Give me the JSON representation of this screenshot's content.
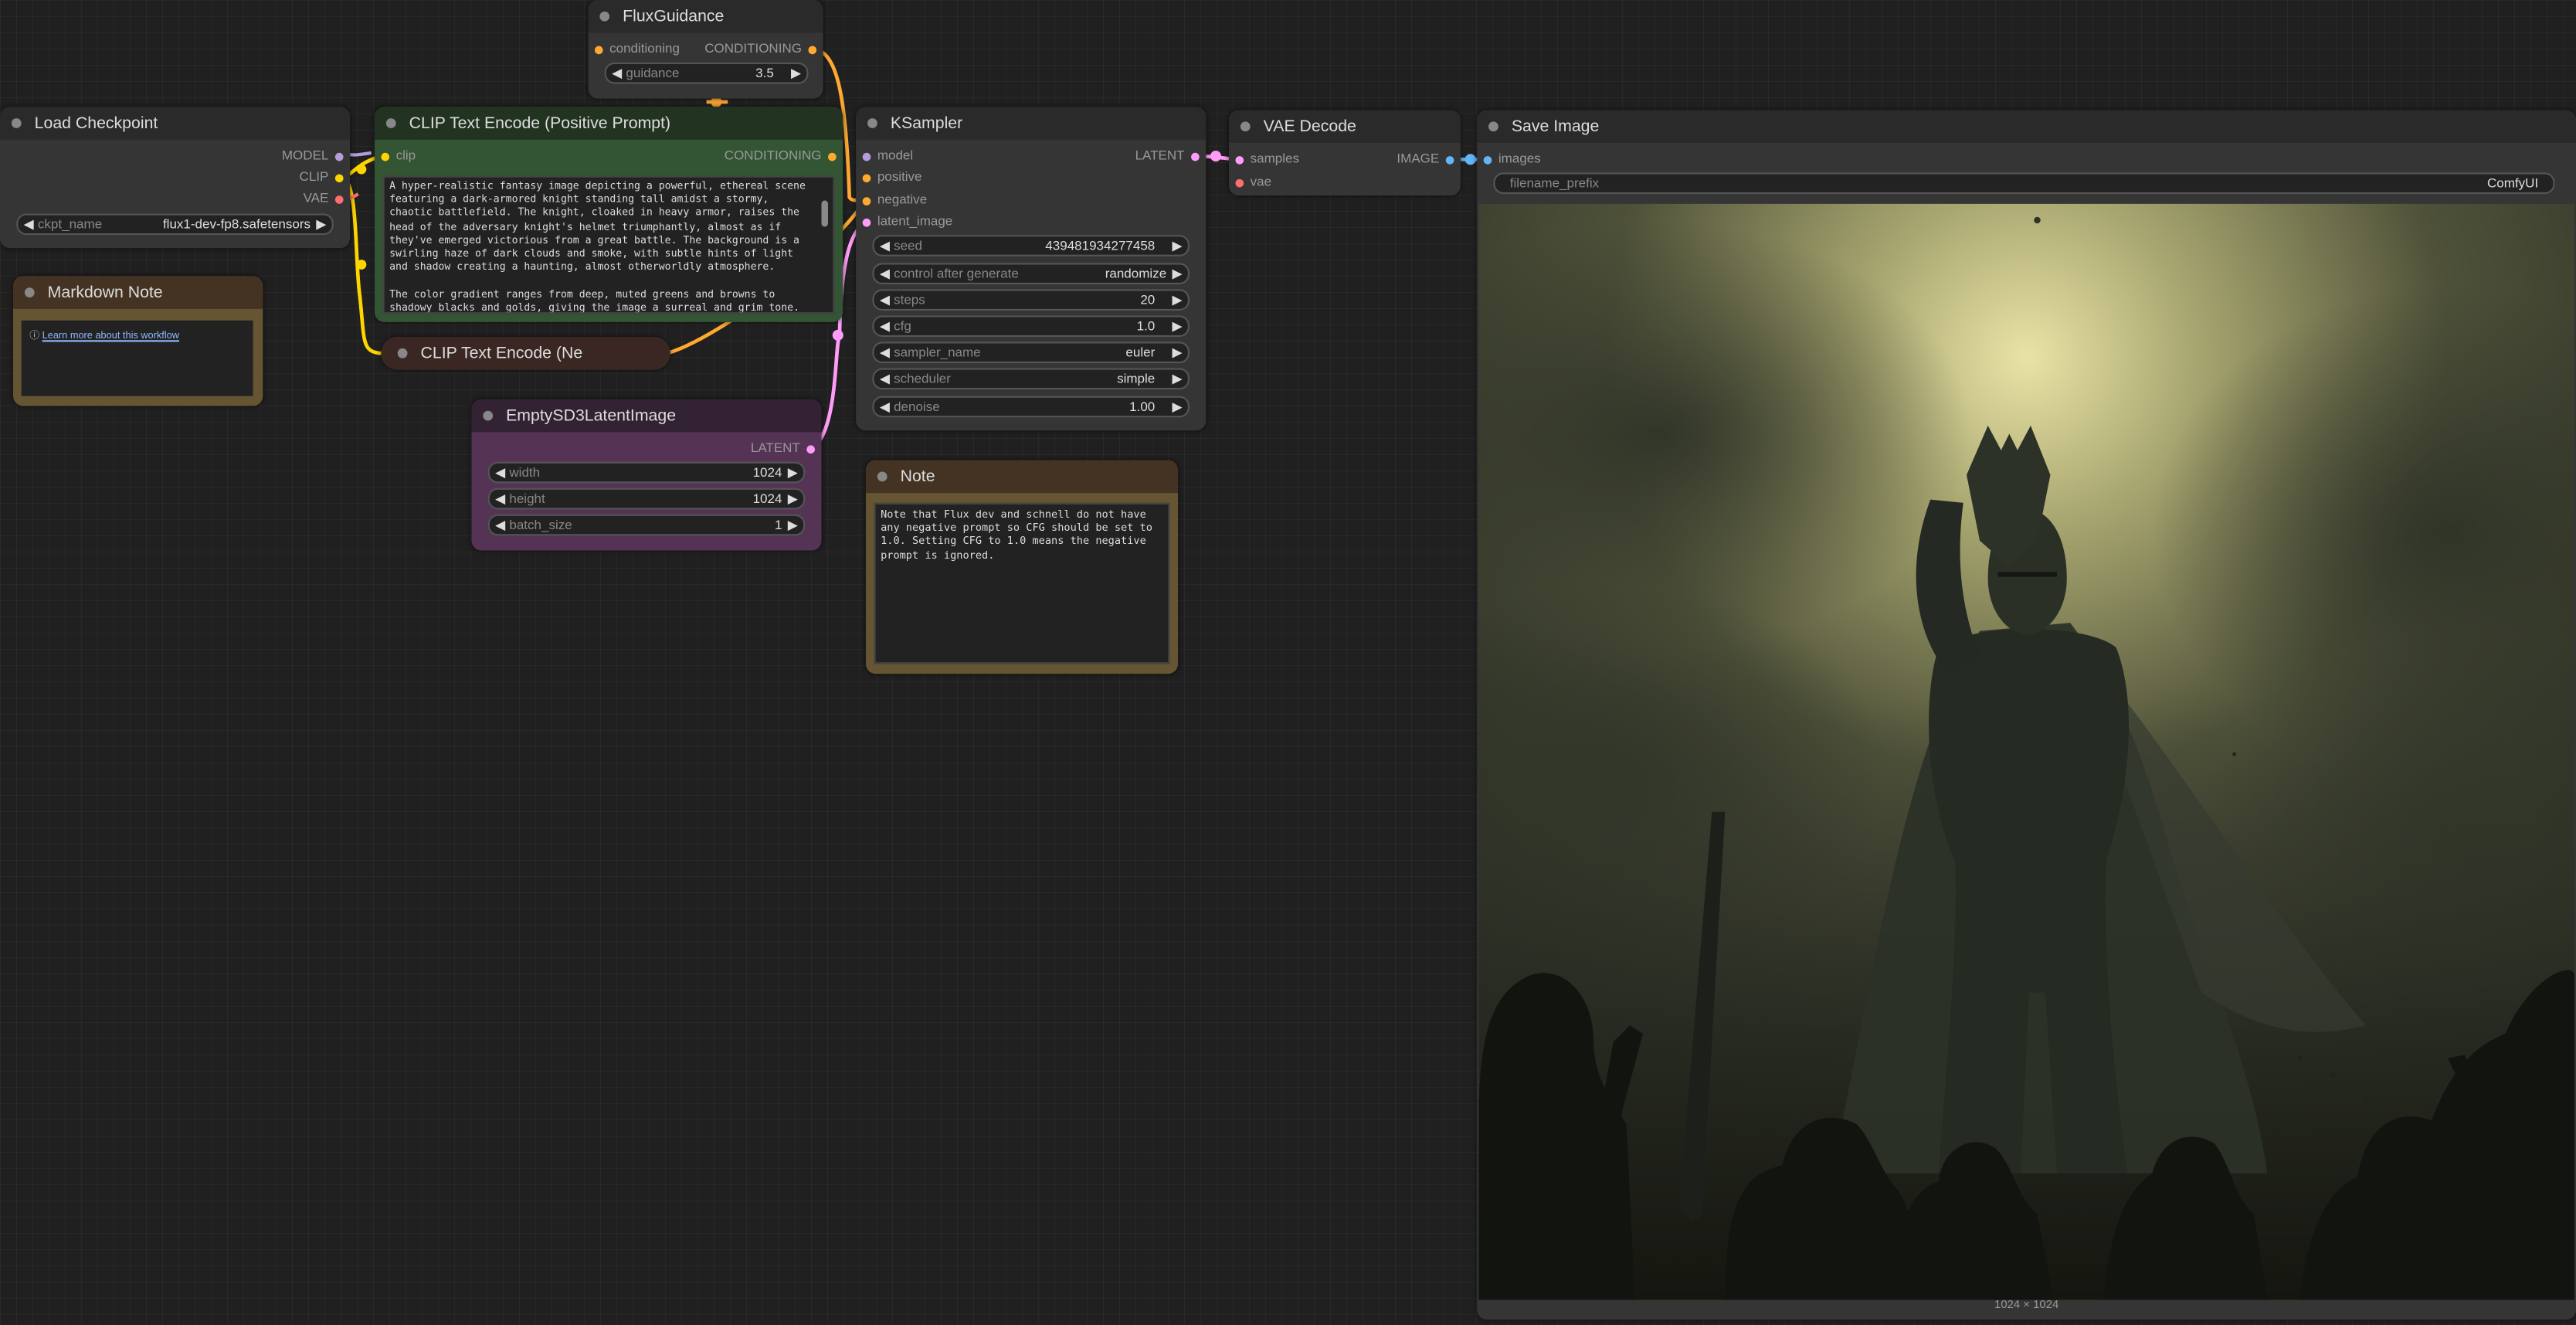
{
  "colors": {
    "canvas_bg": "#202020",
    "node_bg": "#353535",
    "model_wire": "#b39ddb",
    "clip_wire": "#ffd500",
    "vae_wire": "#ff6e6e",
    "conditioning_wire": "#ffa931",
    "latent_wire": "#ff9cf9",
    "image_wire": "#64b5f6"
  },
  "nodes": {
    "load_checkpoint": {
      "title": "Load Checkpoint",
      "outputs": {
        "model": "MODEL",
        "clip": "CLIP",
        "vae": "VAE"
      },
      "ckpt_name": {
        "name": "ckpt_name",
        "value": "flux1-dev-fp8.safetensors"
      }
    },
    "flux_guidance": {
      "title": "FluxGuidance",
      "input_conditioning": "conditioning",
      "output_conditioning": "CONDITIONING",
      "guidance": {
        "name": "guidance",
        "value": "3.5"
      }
    },
    "clip_positive": {
      "title": "CLIP Text Encode (Positive Prompt)",
      "input_clip": "clip",
      "output_conditioning": "CONDITIONING",
      "text": "A hyper-realistic fantasy image depicting a powerful, ethereal scene featuring a dark-armored knight standing tall amidst a stormy, chaotic battlefield. The knight, cloaked in heavy armor, raises the head of the adversary knight's helmet triumphantly, almost as if they've emerged victorious from a great battle. The background is a swirling haze of dark clouds and smoke, with subtle hints of light and shadow creating a haunting, almost otherworldly atmosphere.\n\nThe color gradient ranges from deep, muted greens and browns to shadowy blacks and golds, giving the image a surreal and grim tone. The glow of"
    },
    "clip_negative": {
      "title": "CLIP Text Encode (Ne"
    },
    "empty_latent": {
      "title": "EmptySD3LatentImage",
      "output_latent": "LATENT",
      "width": {
        "name": "width",
        "value": "1024"
      },
      "height": {
        "name": "height",
        "value": "1024"
      },
      "batch_size": {
        "name": "batch_size",
        "value": "1"
      }
    },
    "ksampler": {
      "title": "KSampler",
      "inputs": {
        "model": "model",
        "positive": "positive",
        "negative": "negative",
        "latent_image": "latent_image"
      },
      "output_latent": "LATENT",
      "widgets": {
        "seed": {
          "name": "seed",
          "value": "439481934277458"
        },
        "control_after_generate": {
          "name": "control after generate",
          "value": "randomize"
        },
        "steps": {
          "name": "steps",
          "value": "20"
        },
        "cfg": {
          "name": "cfg",
          "value": "1.0"
        },
        "sampler_name": {
          "name": "sampler_name",
          "value": "euler"
        },
        "scheduler": {
          "name": "scheduler",
          "value": "simple"
        },
        "denoise": {
          "name": "denoise",
          "value": "1.00"
        }
      }
    },
    "vae_decode": {
      "title": "VAE Decode",
      "inputs": {
        "samples": "samples",
        "vae": "vae"
      },
      "output_image": "IMAGE"
    },
    "save_image": {
      "title": "Save Image",
      "input_images": "images",
      "filename_prefix": {
        "name": "filename_prefix",
        "value": "ComfyUI"
      },
      "image_size_label": "1024 × 1024"
    },
    "markdown_note": {
      "title": "Markdown Note",
      "link_icon": "ⓘ",
      "link_text": "Learn more about this workflow"
    },
    "note": {
      "title": "Note",
      "text": "Note that Flux dev and schnell do not have any negative prompt so CFG should be set to 1.0. Setting CFG to 1.0 means the negative prompt is ignored."
    }
  }
}
